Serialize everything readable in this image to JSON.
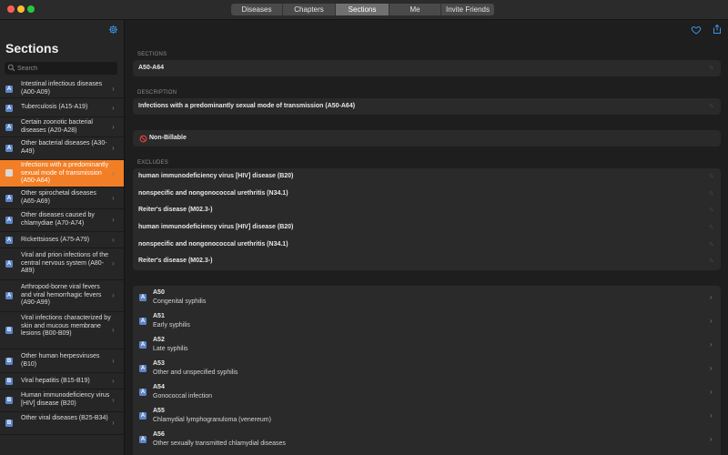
{
  "window": {
    "tabs": [
      "Diseases",
      "Chapters",
      "Sections",
      "Me",
      "Invite Friends"
    ],
    "active_tab": "Sections"
  },
  "sidebar": {
    "title": "Sections",
    "search_placeholder": "Search",
    "items": [
      {
        "badge": "A",
        "label": "Intestinal infectious diseases (A00-A09)"
      },
      {
        "badge": "A",
        "label": "Tuberculosis (A15-A19)"
      },
      {
        "badge": "A",
        "label": "Certain zoonotic bacterial diseases (A20-A28)"
      },
      {
        "badge": "A",
        "label": "Other bacterial diseases (A30-A49)"
      },
      {
        "badge": "A",
        "label": "Infections with a predominantly sexual mode of transmission (A50-A64)"
      },
      {
        "badge": "A",
        "label": "Other spirochetal diseases (A65-A69)"
      },
      {
        "badge": "A",
        "label": "Other diseases caused by chlamydiae (A70-A74)"
      },
      {
        "badge": "A",
        "label": "Rickettsioses (A75-A79)"
      },
      {
        "badge": "A",
        "label": "Viral and prion infections of the central nervous system (A80-A89)"
      },
      {
        "badge": "A",
        "label": "Arthropod-borne viral fevers and viral hemorrhagic fevers (A90-A99)"
      },
      {
        "badge": "B",
        "label": "Viral infections characterized by skin and mucous membrane lesions (B00-B09)"
      },
      {
        "badge": "B",
        "label": "Other human herpesviruses (B10)"
      },
      {
        "badge": "B",
        "label": "Viral hepatitis (B15-B19)"
      },
      {
        "badge": "B",
        "label": "Human immunodeficiency virus [HIV] disease (B20)"
      },
      {
        "badge": "B",
        "label": "Other viral diseases (B25-B34)"
      }
    ],
    "active_index": 4
  },
  "detail": {
    "sections_label": "SECTIONS",
    "sections_value": "A50-A64",
    "description_label": "DESCRIPTION",
    "description_value": "Infections with a predominantly sexual mode of transmission (A50-A64)",
    "billable_status": "Non-Billable",
    "excludes_label": "EXCLUDES",
    "excludes": [
      "human immunodeficiency virus [HIV] disease (B20)",
      "nonspecific and nongonococcal urethritis (N34.1)",
      "Reiter's disease (M02.3-)",
      "human immunodeficiency virus [HIV] disease (B20)",
      "nonspecific and nongonococcal urethritis (N34.1)",
      "Reiter's disease (M02.3-)"
    ],
    "categories": [
      {
        "badge": "A",
        "code": "A50",
        "name": "Congenital syphilis"
      },
      {
        "badge": "A",
        "code": "A51",
        "name": "Early syphilis"
      },
      {
        "badge": "A",
        "code": "A52",
        "name": "Late syphilis"
      },
      {
        "badge": "A",
        "code": "A53",
        "name": "Other and unspecified syphilis"
      },
      {
        "badge": "A",
        "code": "A54",
        "name": "Gonococcal infection"
      },
      {
        "badge": "A",
        "code": "A55",
        "name": "Chlamydial lymphogranuloma (venereum)"
      },
      {
        "badge": "A",
        "code": "A56",
        "name": "Other sexually transmitted chlamydial diseases"
      }
    ]
  },
  "colors": {
    "accent_orange": "#f27f26",
    "link_blue": "#3c94e8",
    "badge_blue": "#5d86c9",
    "non_billable_red": "#e0443c"
  }
}
